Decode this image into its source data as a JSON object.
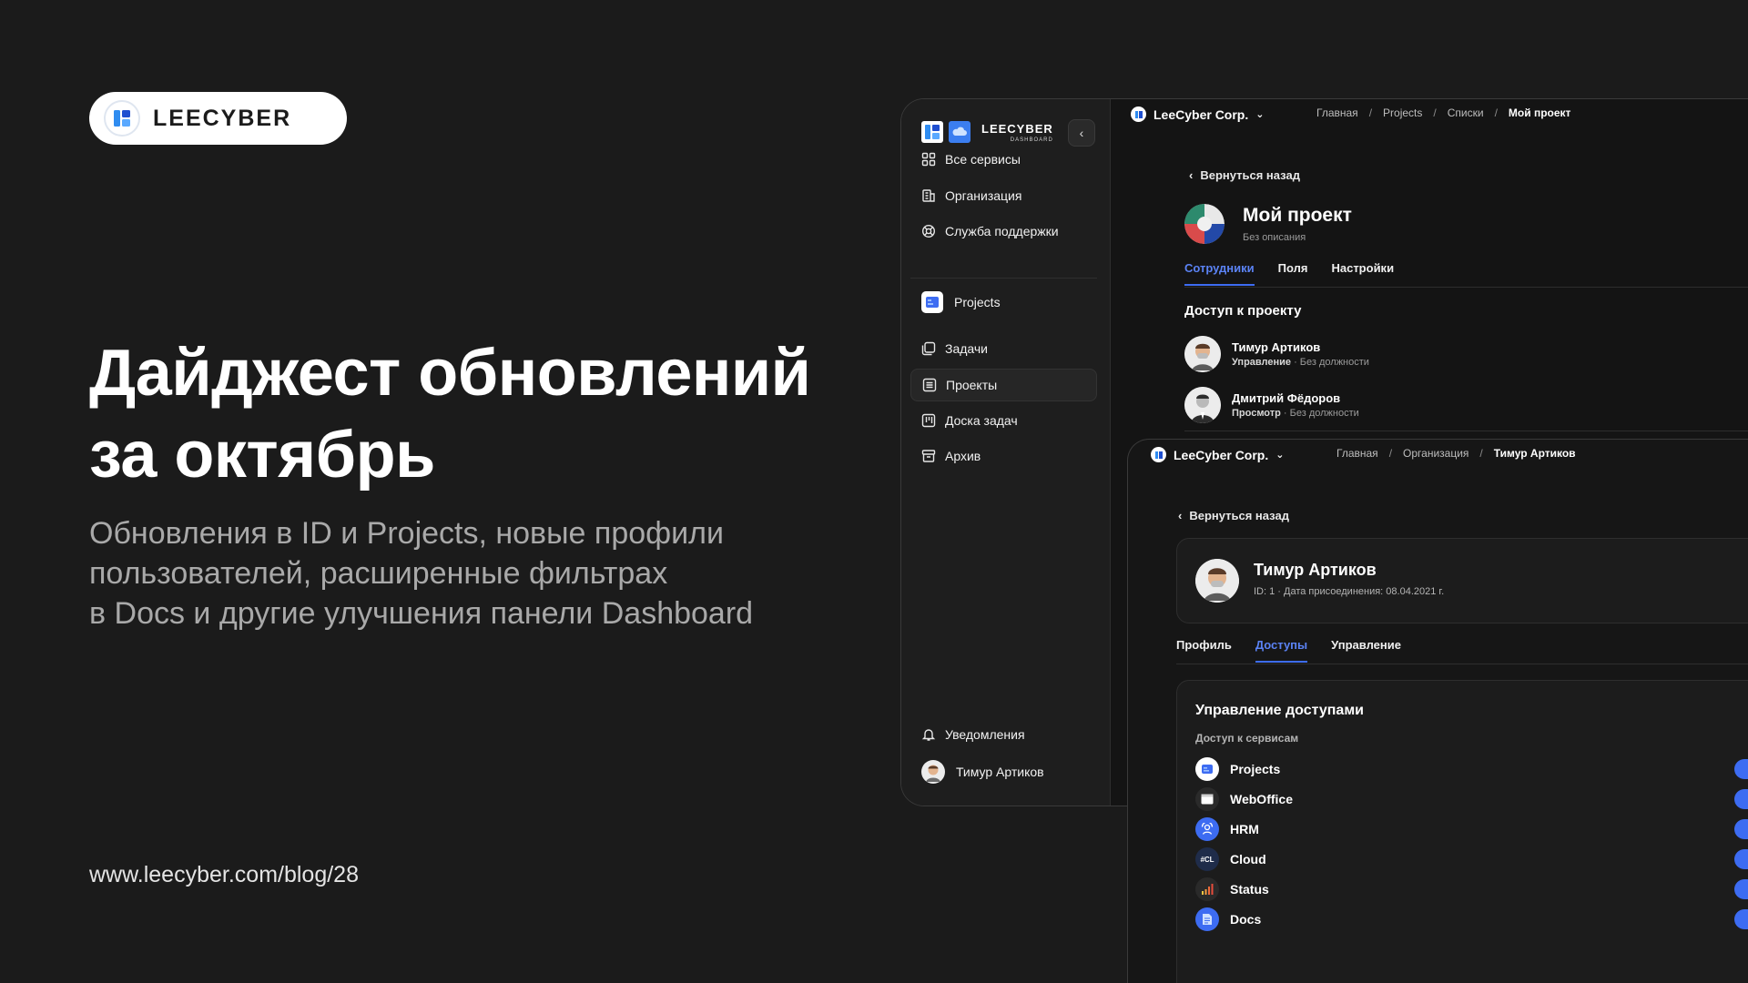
{
  "brand": {
    "logo_text": "LEECYBER"
  },
  "hero": {
    "headline": "Дайджест обновлений за октябрь",
    "subtitle": "Обновления в ID и Projects, новые профили\nпользователей, расширенные фильтрах\nв Docs и другие улучшения панели Dashboard",
    "url": "www.leecyber.com/blog/28"
  },
  "colors": {
    "background": "#1b1b1b",
    "accent": "#3d6cf2",
    "panel": "#141414"
  },
  "sidebar": {
    "brand": "LEECYBER",
    "brand_sub": "DASHBOARD",
    "collapse_icon": "chevron-left-icon",
    "top_items": [
      {
        "label": "Все сервисы",
        "icon": "grid-icon"
      },
      {
        "label": "Организация",
        "icon": "building-icon"
      },
      {
        "label": "Служба поддержки",
        "icon": "lifebuoy-icon"
      }
    ],
    "service": {
      "label": "Projects",
      "icon": "projects-app-icon"
    },
    "service_items": [
      {
        "label": "Задачи",
        "icon": "tasks-icon"
      },
      {
        "label": "Проекты",
        "icon": "list-icon",
        "active": true
      },
      {
        "label": "Доска задач",
        "icon": "board-icon"
      },
      {
        "label": "Архив",
        "icon": "archive-icon"
      }
    ],
    "notifications": "Уведомления",
    "user": "Тимур Артиков"
  },
  "project_window": {
    "org": "LeeCyber Corp.",
    "breadcrumbs": [
      "Главная",
      "Projects",
      "Списки",
      "Мой проект"
    ],
    "back": "Вернуться назад",
    "title": "Мой проект",
    "description": "Без описания",
    "tabs": [
      "Сотрудники",
      "Поля",
      "Настройки"
    ],
    "active_tab": 0,
    "section": "Доступ к проекту",
    "members": [
      {
        "name": "Тимур Артиков",
        "role": "Управление",
        "position": " · Без должности"
      },
      {
        "name": "Дмитрий Фёдоров",
        "role": "Просмотр",
        "position": " · Без должности"
      }
    ]
  },
  "profile_window": {
    "org": "LeeCyber Corp.",
    "breadcrumbs": [
      "Главная",
      "Организация",
      "Тимур Артиков"
    ],
    "back": "Вернуться назад",
    "user_name": "Тимур Артиков",
    "user_meta": "ID: 1 · Дата присоединения: 08.04.2021 г.",
    "tabs": [
      "Профиль",
      "Доступы",
      "Управление"
    ],
    "active_tab": 1,
    "card_title": "Управление доступами",
    "card_sub": "Доступ к сервисам",
    "services": [
      {
        "name": "Projects",
        "icon": "projects-app-icon",
        "color": "#ffffff",
        "enabled": true
      },
      {
        "name": "WebOffice",
        "icon": "weboffice-icon",
        "color": "#2a2a2a",
        "enabled": true
      },
      {
        "name": "HRM",
        "icon": "hrm-icon",
        "color": "#3d6cf2",
        "enabled": true
      },
      {
        "name": "Cloud",
        "icon": "cloud-icon",
        "color": "#1f2c4a",
        "badge": "#CL",
        "enabled": true
      },
      {
        "name": "Status",
        "icon": "status-bars-icon",
        "color": "#2a2a2a",
        "enabled": true
      },
      {
        "name": "Docs",
        "icon": "docs-icon",
        "color": "#3d6cf2",
        "enabled": true
      }
    ]
  }
}
